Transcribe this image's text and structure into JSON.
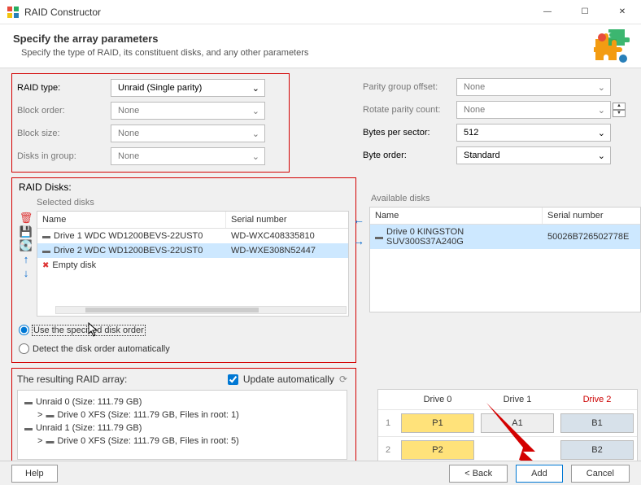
{
  "window": {
    "title": "RAID Constructor"
  },
  "header": {
    "title": "Specify the array parameters",
    "subtitle": "Specify the type of RAID, its constituent disks, and any other parameters"
  },
  "left_params": {
    "raid_type": {
      "label": "RAID type:",
      "value": "Unraid (Single parity)"
    },
    "block_order": {
      "label": "Block order:",
      "value": "None"
    },
    "block_size": {
      "label": "Block size:",
      "value": "None"
    },
    "disks_in_group": {
      "label": "Disks in group:",
      "value": "None"
    }
  },
  "right_params": {
    "parity_offset": {
      "label": "Parity group offset:",
      "value": "None"
    },
    "rotate_count": {
      "label": "Rotate parity count:",
      "value": "None"
    },
    "bytes_sector": {
      "label": "Bytes per sector:",
      "value": "512"
    },
    "byte_order": {
      "label": "Byte order:",
      "value": "Standard"
    }
  },
  "raid_disks": {
    "title": "RAID Disks:",
    "selected_label": "Selected disks",
    "available_label": "Available disks",
    "cols": {
      "name": "Name",
      "serial": "Serial number"
    },
    "selected": [
      {
        "name": "Drive 1 WDC WD1200BEVS-22UST0",
        "serial": "WD-WXC408335810"
      },
      {
        "name": "Drive 2 WDC WD1200BEVS-22UST0",
        "serial": "WD-WXE308N52447"
      },
      {
        "name": "Empty disk",
        "serial": ""
      }
    ],
    "available": [
      {
        "name": "Drive 0 KINGSTON SUV300S37A240G",
        "serial": "50026B726502778E"
      }
    ],
    "radio": {
      "specified": "Use the specified disk order",
      "detect": "Detect the disk order automatically"
    }
  },
  "resulting": {
    "title": "The resulting RAID array:",
    "update_label": "Update automatically",
    "items": [
      {
        "indent": 0,
        "text": "Unraid 0 (Size: 111.79 GB)"
      },
      {
        "indent": 1,
        "text": "Drive 0 XFS (Size: 111.79 GB, Files in root: 1)",
        "expand": ">"
      },
      {
        "indent": 0,
        "text": "Unraid 1 (Size: 111.79 GB)"
      },
      {
        "indent": 1,
        "text": "Drive 0 XFS (Size: 111.79 GB, Files in root: 5)",
        "expand": ">"
      }
    ]
  },
  "drive_grid": {
    "headers": [
      "Drive 0",
      "Drive 1",
      "Drive 2"
    ],
    "rows": [
      {
        "num": "1",
        "cells": [
          "P1",
          "A1",
          "B1"
        ]
      },
      {
        "num": "2",
        "cells": [
          "P2",
          "",
          "B2"
        ]
      }
    ]
  },
  "footer": {
    "help": "Help",
    "back": "< Back",
    "add": "Add",
    "cancel": "Cancel"
  }
}
